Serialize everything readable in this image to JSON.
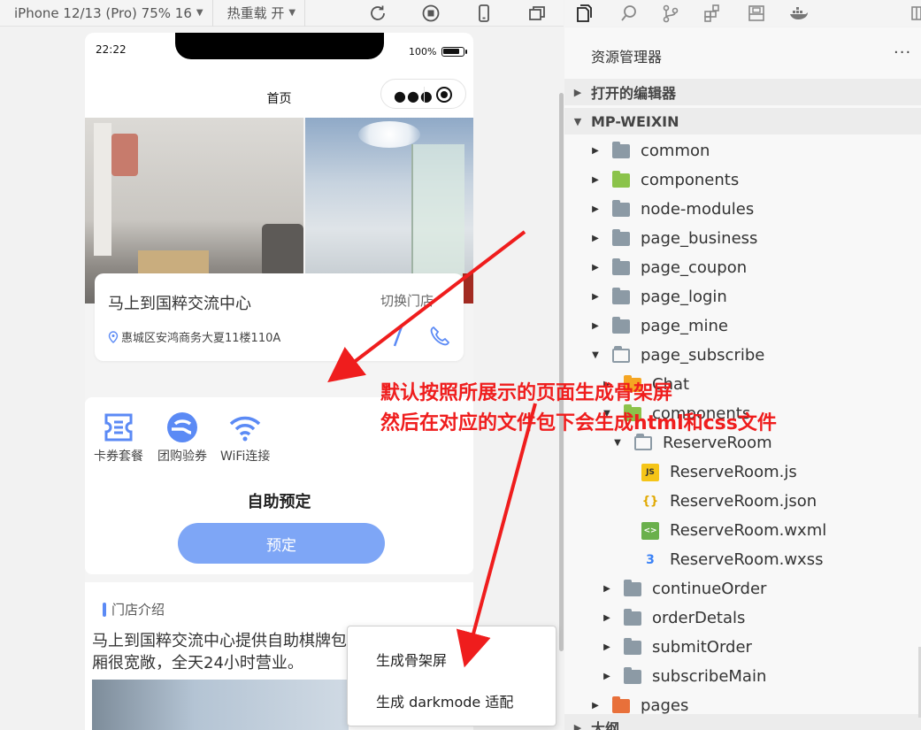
{
  "toolbar": {
    "device_select": "iPhone 12/13 (Pro) 75% 16",
    "hot_reload": "热重载 开",
    "icons": [
      "refresh-icon",
      "stop-icon",
      "phone-icon",
      "windows-icon"
    ]
  },
  "right_toolbar": {
    "icons": [
      "files-icon",
      "search-icon",
      "source-control-icon",
      "extensions-icon",
      "layout-icon",
      "docker-icon",
      "split-icon"
    ]
  },
  "phone": {
    "status": {
      "time": "22:22",
      "battery": "100%"
    },
    "nav_title": "首页",
    "store": {
      "name": "马上到国粹交流中心",
      "switch": "切换门店",
      "address": "惠城区安鸿商务大夏11楼110A"
    },
    "services": [
      {
        "label": "卡券套餐"
      },
      {
        "label": "团购验券"
      },
      {
        "label": "WiFi连接"
      }
    ],
    "self_booking_title": "自助预定",
    "book_button": "预定",
    "intro": {
      "title": "门店介绍",
      "text": "马上到国粹交流中心提供自助棋牌包厢很宽敞，全天24小时营业。"
    }
  },
  "context_menu": {
    "items": [
      "生成骨架屏",
      "生成 darkmode 适配"
    ]
  },
  "explorer": {
    "title": "资源管理器",
    "more": "···",
    "sections": [
      "打开的编辑器",
      "MP-WEIXIN",
      "大纲"
    ],
    "tree": [
      {
        "label": "common",
        "level": 1,
        "type": "folder",
        "open": false
      },
      {
        "label": "components",
        "level": 1,
        "type": "folder-green",
        "open": false
      },
      {
        "label": "node-modules",
        "level": 1,
        "type": "folder",
        "open": false
      },
      {
        "label": "page_business",
        "level": 1,
        "type": "folder",
        "open": false
      },
      {
        "label": "page_coupon",
        "level": 1,
        "type": "folder",
        "open": false
      },
      {
        "label": "page_login",
        "level": 1,
        "type": "folder",
        "open": false
      },
      {
        "label": "page_mine",
        "level": 1,
        "type": "folder",
        "open": false
      },
      {
        "label": "page_subscribe",
        "level": 1,
        "type": "folder-open",
        "open": true
      },
      {
        "label": "Chat",
        "level": 2,
        "type": "folder-orange",
        "open": false
      },
      {
        "label": "components",
        "level": 2,
        "type": "folder-green",
        "open": true
      },
      {
        "label": "ReserveRoom",
        "level": 3,
        "type": "folder-open",
        "open": true
      },
      {
        "label": "ReserveRoom.js",
        "level": 4,
        "type": "js"
      },
      {
        "label": "ReserveRoom.json",
        "level": 4,
        "type": "json"
      },
      {
        "label": "ReserveRoom.wxml",
        "level": 4,
        "type": "wxml"
      },
      {
        "label": "ReserveRoom.wxss",
        "level": 4,
        "type": "wxss"
      },
      {
        "label": "continueOrder",
        "level": 2,
        "type": "folder",
        "open": false
      },
      {
        "label": "orderDetals",
        "level": 2,
        "type": "folder",
        "open": false
      },
      {
        "label": "submitOrder",
        "level": 2,
        "type": "folder",
        "open": false
      },
      {
        "label": "subscribeMain",
        "level": 2,
        "type": "folder",
        "open": false
      },
      {
        "label": "pages",
        "level": 1,
        "type": "folder-red",
        "open": false
      }
    ]
  },
  "annotation": {
    "line1": "默认按照所展示的页面生成骨架屏",
    "line2": "然后在对应的文件包下会生成html和css文件",
    "color": "#ef1d1d"
  },
  "colors": {
    "accent_button": "#7ea6f6",
    "annotation_red": "#ef1d1d",
    "folder_gray": "#8c9aa5",
    "folder_green": "#8bc34a"
  }
}
